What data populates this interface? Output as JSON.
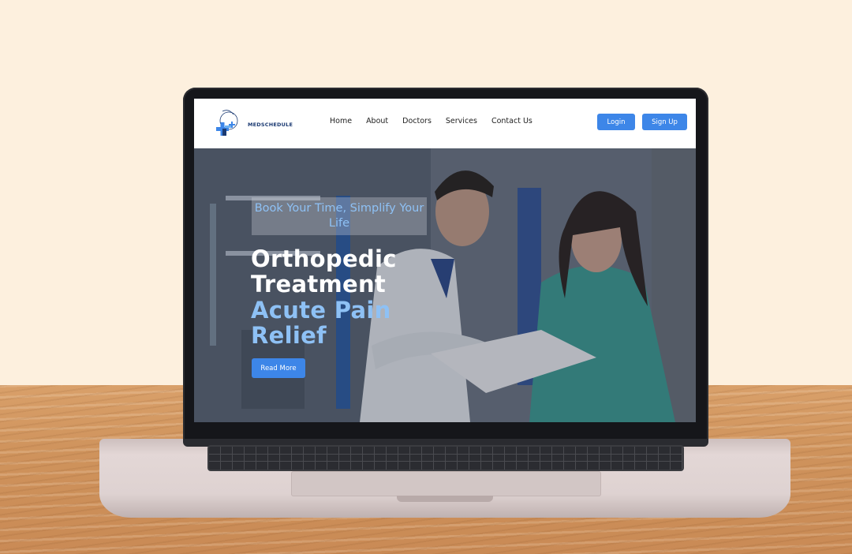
{
  "brand": {
    "name": "MEDSCHEDULE"
  },
  "nav": {
    "links": [
      "Home",
      "About",
      "Doctors",
      "Services",
      "Contact Us"
    ],
    "login_label": "Login",
    "signup_label": "Sign Up"
  },
  "hero": {
    "tagline": "Book Your Time, Simplify Your Life",
    "heading_line1": "Orthopedic",
    "heading_line2": "Treatment",
    "heading_line3": "Acute Pain",
    "heading_line4": "Relief",
    "cta_label": "Read More"
  },
  "colors": {
    "accent": "#3d86e8",
    "highlight_text": "#8ec1f5",
    "wall": "#fdf0de",
    "desk": "#cf935c"
  },
  "icons": [
    "medical-cross-logo-icon"
  ]
}
